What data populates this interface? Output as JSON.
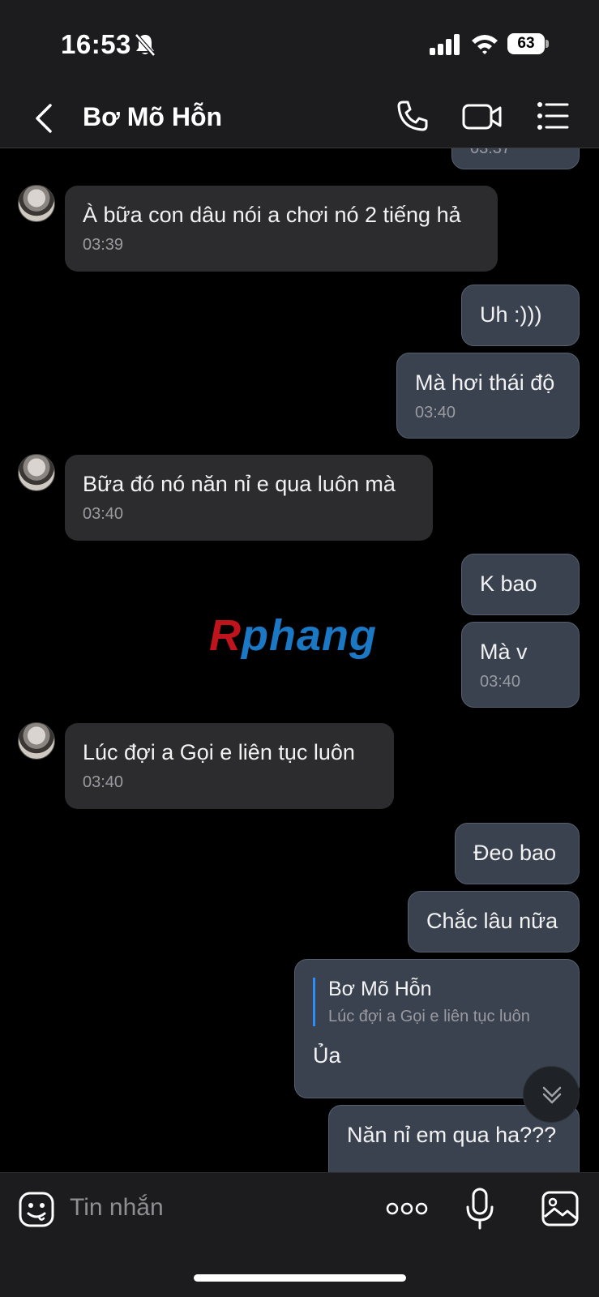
{
  "status_bar": {
    "time": "16:53",
    "battery": "63"
  },
  "header": {
    "title": "Bơ Mõ Hỗn"
  },
  "messages": [
    {
      "side": "out",
      "time": "03:37"
    },
    {
      "side": "in",
      "text": "À bữa con dâu nói a chơi nó 2 tiếng hả",
      "time": "03:39"
    },
    {
      "side": "out",
      "text": "Uh :)))"
    },
    {
      "side": "out",
      "text": "Mà hơi thái độ",
      "time": "03:40"
    },
    {
      "side": "in",
      "text": "Bữa đó nó năn nỉ e qua luôn mà",
      "time": "03:40"
    },
    {
      "side": "out",
      "text": "K bao"
    },
    {
      "side": "out",
      "text": "Mà v",
      "time": "03:40"
    },
    {
      "side": "in",
      "text": "Lúc đợi a Gọi e liên tục luôn",
      "time": "03:40"
    },
    {
      "side": "out",
      "text": "Đeo bao"
    },
    {
      "side": "out",
      "text": "Chắc lâu nữa"
    },
    {
      "side": "out",
      "reply_to": {
        "name": "Bơ Mõ Hỗn",
        "snippet": "Lúc đợi a Gọi e liên tục luôn"
      },
      "text": "Ủa"
    },
    {
      "side": "out",
      "text": "Năn nỉ em qua ha???"
    }
  ],
  "watermark": {
    "first": "R",
    "rest": "phang"
  },
  "composer": {
    "placeholder": "Tin nhắn"
  },
  "colors": {
    "incoming_bubble": "#2c2c2e",
    "outgoing_bubble": "#3a4250",
    "accent": "#2f8cff"
  }
}
